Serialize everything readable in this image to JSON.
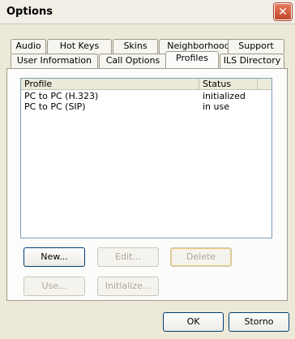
{
  "window": {
    "title": "Options",
    "close_glyph": "✕"
  },
  "tabs_row1": [
    "Audio",
    "Hot Keys",
    "Skins",
    "Neighborhood",
    "Support"
  ],
  "tabs_row2": [
    "User Information",
    "Call Options",
    "Profiles",
    "ILS Directory"
  ],
  "active_tab": "Profiles",
  "profiles": {
    "columns": [
      "Profile",
      "Status"
    ],
    "rows": [
      {
        "profile": "PC to PC (H.323)",
        "status": "initialized"
      },
      {
        "profile": "PC to PC (SIP)",
        "status": "in use"
      }
    ]
  },
  "buttons": {
    "new": "New...",
    "edit": "Edit...",
    "delete": "Delete",
    "use": "Use...",
    "initialize": "Initialize..."
  },
  "footer": {
    "ok": "OK",
    "cancel": "Storno"
  },
  "colors": {
    "accent_border": "#003c74",
    "close_button": "#d0583b"
  }
}
